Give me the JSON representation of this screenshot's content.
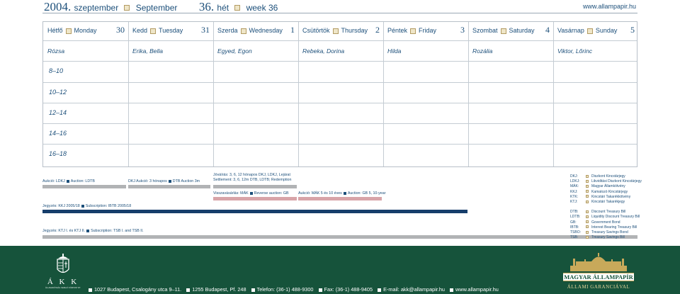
{
  "header": {
    "year": "2004.",
    "month_hu": "szeptember",
    "month_en": "September",
    "week_num": "36.",
    "week_hu": "hét",
    "week_en": "week 36",
    "website": "www.allampapir.hu"
  },
  "days": [
    {
      "hu": "Hétfő",
      "en": "Monday",
      "num": "30",
      "names": "Rózsa"
    },
    {
      "hu": "Kedd",
      "en": "Tuesday",
      "num": "31",
      "names": "Erika, Bella"
    },
    {
      "hu": "Szerda",
      "en": "Wednesday",
      "num": "1",
      "names": "Egyed, Egon"
    },
    {
      "hu": "Csütörtök",
      "en": "Thursday",
      "num": "2",
      "names": "Rebeka, Dorina"
    },
    {
      "hu": "Péntek",
      "en": "Friday",
      "num": "3",
      "names": "Hilda"
    },
    {
      "hu": "Szombat",
      "en": "Saturday",
      "num": "4",
      "names": "Rozália"
    },
    {
      "hu": "Vasárnap",
      "en": "Sunday",
      "num": "5",
      "names": "Viktor, Lőrinc"
    }
  ],
  "time_slots": [
    "8–10",
    "10–12",
    "12–14",
    "14–16",
    "16–18"
  ],
  "events": {
    "mon_auction": "Aukció: LDKJ",
    "mon_auction_en": "Auction: LDTB",
    "tue_auction": "DKJ Aukció: 3 hónapos",
    "tue_auction_en": "DTB Auction 3m",
    "wed_settle": "Jóváírás: 3, 6, 12 hónapos DKJ, LDKJ, Lejárat",
    "wed_settle_en": "Settlement: 3, 6, 12m DTB, LDTB; Redemption",
    "wed_buyback": "Visszavásárlás: MÁK",
    "wed_buyback_en": "Reverse auction: GB",
    "thu_auction": "Aukció: MÁK 5 és 10 éves",
    "thu_auction_en": "Auction: GB 5, 10-year",
    "sub1": "Jegyzés: KKJ 2005/18",
    "sub1_en": "Subscription: IBTB 2005/18",
    "sub2": "Jegyzés: KTJ I. és KTJ II.",
    "sub2_en": "Subscription: TSB I. and TSB II."
  },
  "legend": [
    {
      "k": "DKJ:",
      "v": "Diszkont Kincstárjegy"
    },
    {
      "k": "LDKJ:",
      "v": "Likviditási Diszkont Kincstárjegy"
    },
    {
      "k": "MÁK:",
      "v": "Magyar Államkötvény"
    },
    {
      "k": "KKJ:",
      "v": "Kamatozó Kincstárjegy"
    },
    {
      "k": "KTK:",
      "v": "Kincstári Takarékkötvény"
    },
    {
      "k": "KTJ:",
      "v": "Kincstári Takarékjegy"
    },
    {
      "k": "",
      "v": ""
    },
    {
      "k": "DTB:",
      "v": "Discount Treasury Bill"
    },
    {
      "k": "LDTB:",
      "v": "Liquidity Discount Treasury Bill"
    },
    {
      "k": "GB:",
      "v": "Government Bond"
    },
    {
      "k": "IBTB:",
      "v": "Interest Bearing Treasury Bill"
    },
    {
      "k": "TSBO:",
      "v": "Treasury Savings Bond"
    },
    {
      "k": "TSB:",
      "v": "Treasury Savings Bill"
    }
  ],
  "footer": {
    "akk_logo": "Á K K",
    "akk_sub": "ÁLLAMADÓSSÁG KEZELŐ KÖZPONT RT.",
    "address": "1027 Budapest, Csalogány utca 9–11.",
    "po_box": "1255 Budapest, Pf. 248",
    "phone": "Telefon: (36-1) 488-9300",
    "fax": "Fax: (36-1) 488-9405",
    "email": "E-mail: akk@allampapir.hu",
    "web": "www.allampapir.hu",
    "brand": "MAGYAR ÁLLAMPAPÍR",
    "brand_sub": "ÁLLAMI GARANCIÁVAL"
  },
  "colors": {
    "navy": "#1c4f7a",
    "footer_green": "#16533b",
    "bar_grey": "#b1b3b5",
    "bar_rose": "#d8a4a8",
    "bar_navy": "#163e6b",
    "gold": "#c8a95a"
  }
}
